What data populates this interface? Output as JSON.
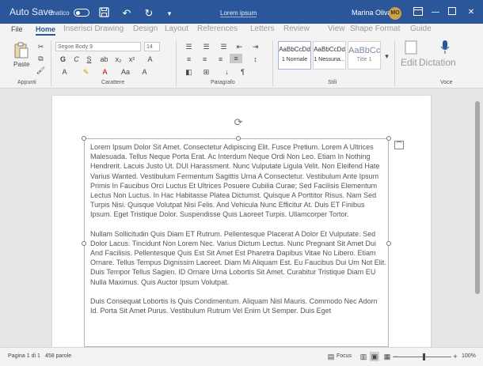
{
  "titlebar": {
    "autosave": "Auto Save",
    "autosave_small": "matico",
    "doc_title": "Lorem ipsum",
    "user": "Marina Oliva",
    "avatar": "MO",
    "icons": [
      "save-icon",
      "undo-icon",
      "redo-icon",
      "customize-icon",
      "ribbon-display-icon",
      "minimize-icon",
      "maximize-icon",
      "close-icon"
    ]
  },
  "tabs": {
    "file": "File",
    "home": "Home",
    "insert_draw": "Inserisci Drawing",
    "design": "Design",
    "layout": "Layout",
    "references": "References",
    "letters": "Letters",
    "review": "Review",
    "view": "View",
    "shape_format": "Shape Format",
    "guide": "Guide"
  },
  "ribbon": {
    "paste": "Paste",
    "font_name": "Segoe Body 9",
    "font_size": "14",
    "groups": {
      "clipboard": "Appunti",
      "font": "Carattere",
      "paragraph": "Paragrafo",
      "styles": "Stili",
      "voice": "Voce"
    },
    "styles": [
      {
        "preview": "AaBbCcDd",
        "label": "1 Normale"
      },
      {
        "preview": "AaBbCcDd",
        "label": "1 Nessuna..."
      },
      {
        "preview": "AaBbCc",
        "label": "Title 1"
      }
    ],
    "edit": "Edit",
    "dictation": "Dictation"
  },
  "document": {
    "paragraphs": [
      "Lorem Ipsum Dolor Sit Amet. Consectetur Adipiscing Elit. Fusce Pretium. Lorem A Ultrices Malesuada. Tellus Neque Porta Erat. Ac Interdum Neque Ordi Non Leo. Etiam In Nothing Hendrerit. Lacuis Justo Ut. DUI Harassment. Nunc Vulputate Ligula Velit. Non Eleifend Hate Varius Wanted. Vestibulum Fermentum Sagittis Urna A Consectetur. Vestibulum Ante Ipsum Primis In Faucibus Orci Luctus Et Ultrices Posuere Cubilia Curae; Sed Facilisis Elementum Lectus Non Luctus. In Hac Habitasse Platea Dictumst. Quisque A Porttitor Risus. Nam Sed Turpis Nisi. Quisque Volutpat Nisi Felis. And Vehicula Nunc Efficitur At. Duis ET Finibus Ipsum. Eget Tristique Dolor. Suspendisse Quis Laoreet Turpis. Ullamcorper Tortor.",
      "Nullam Sollicitudin Quis Diam ET Rutrum. Pellentesque Placerat A Dolor Et Vulputate. Sed Dolor Lacus. Tincidunt Non Lorem Nec. Varius Dictum Lectus. Nunc Pregnant Sit Amet Dui And Facilisis. Pellentesque Quis Est Sit Amet Est Pharetra Dapibus Vitae No Libero. Etiam Ornare. Tellus Tempus Dignissim Laoreet. Diam Mi Aliquam Est. Eu Faucibus Dui Um Not Elit. Duis Tempor Tellus Sagien. ID Ornare Urna Lobortis Sit Amet. Curabitur Tristique Diam EU Nulla Maximus. Quis Auctor Ipsum Volutpat.",
      "Duis Consequat Lobortis Is Quis Condimentum. Aliquam Nisl Mauris. Commodo Nec Adorn Id. Porta Sit Amet Purus. Vestibulum Rutrum Vel Enim Ut Semper. Duis Eget"
    ]
  },
  "statusbar": {
    "page": "Pagina 1 di 1",
    "words": "458 parole",
    "focus": "Focus",
    "zoom": "100%"
  }
}
